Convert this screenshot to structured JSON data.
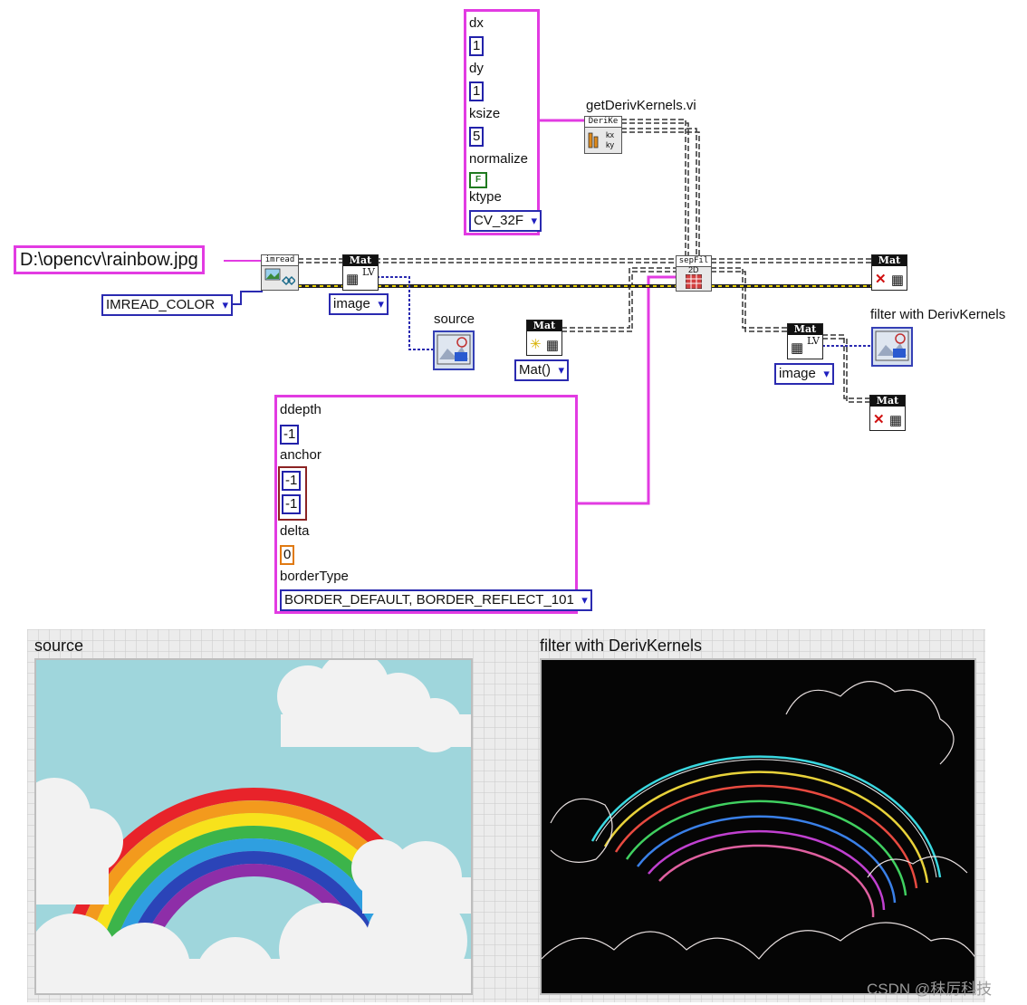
{
  "params_cluster": {
    "dx_label": "dx",
    "dx_value": "1",
    "dy_label": "dy",
    "dy_value": "1",
    "ksize_label": "ksize",
    "ksize_value": "5",
    "normalize_label": "normalize",
    "normalize_value": "F",
    "ktype_label": "ktype",
    "ktype_value": "CV_32F"
  },
  "deriv_vi": {
    "label": "getDerivKernels.vi",
    "icon_text": "DeriKe",
    "out1": "kx",
    "out2": "ky"
  },
  "path_control": {
    "value": "D:\\opencv\\rainbow.jpg"
  },
  "imread": {
    "icon_text": "imread",
    "mode_value": "IMREAD_COLOR"
  },
  "mat_to_image_1": {
    "header": "Mat",
    "lv_text": "LV",
    "type_value": "image"
  },
  "source_indicator_label": "source",
  "mat_empty": {
    "header": "Mat",
    "type_value": "Mat()"
  },
  "sepfilter": {
    "icon_text": "sepFil",
    "sub_text": "2D"
  },
  "mat_release_1": {
    "header": "Mat"
  },
  "mat_release_2": {
    "header": "Mat"
  },
  "mat_to_image_2": {
    "header": "Mat",
    "lv_text": "LV",
    "type_value": "image"
  },
  "filter_indicator_label": "filter with DerivKernels",
  "filter_cluster": {
    "ddepth_label": "ddepth",
    "ddepth_value": "-1",
    "anchor_label": "anchor",
    "anchor_x": "-1",
    "anchor_y": "-1",
    "delta_label": "delta",
    "delta_value": "0",
    "bordertype_label": "borderType",
    "bordertype_value": "BORDER_DEFAULT, BORDER_REFLECT_101"
  },
  "front_panel": {
    "source_title": "source",
    "filter_title": "filter with DerivKernels"
  },
  "watermark": "CSDN @秣厉科技",
  "colors": {
    "cluster_wire": "#e23be2",
    "enum_border": "#2a2ab0",
    "image_wire": "#c8b400",
    "mat_wire": "#333333"
  }
}
